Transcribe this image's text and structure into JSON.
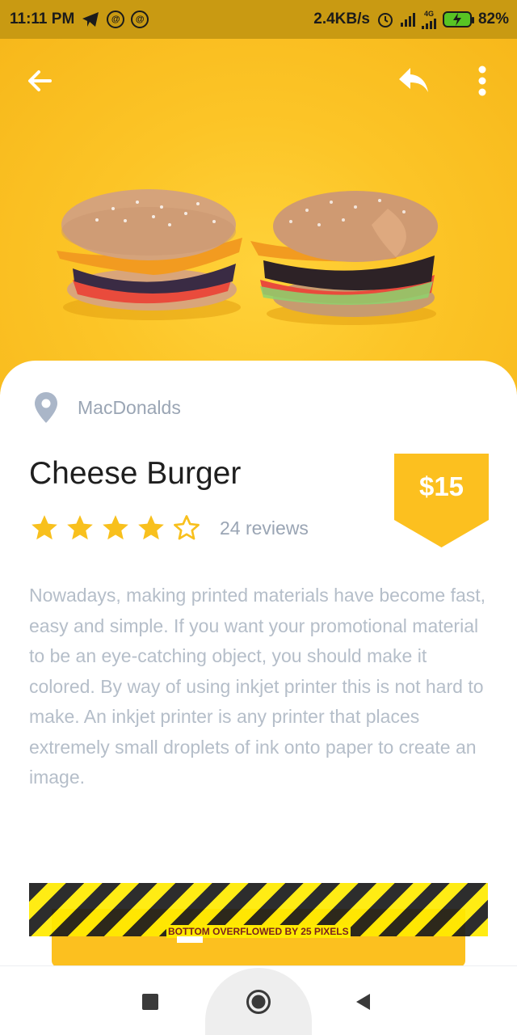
{
  "status_bar": {
    "time": "11:11 PM",
    "network_speed": "2.4KB/s",
    "network_type": "4G",
    "battery": "82%",
    "icons": [
      "telegram-icon",
      "sync-icon",
      "sync-icon",
      "alarm-icon",
      "signal-icon",
      "signal-icon",
      "battery-charging-icon"
    ]
  },
  "app_bar": {
    "icons": [
      "back-arrow-icon",
      "share-icon",
      "more-vert-icon"
    ]
  },
  "product": {
    "location_icon": "location-pin-icon",
    "location": "MacDonalds",
    "title": "Cheese Burger",
    "rating": 4,
    "rating_max": 5,
    "reviews": "24 reviews",
    "price": "$15",
    "description": "Nowadays, making printed materials have become fast, easy and simple. If you want your promotional material to be an eye-catching object, you should make it colored. By way of using inkjet printer this is not hard to make. An inkjet printer is any printer that places extremely small droplets of ink onto paper to create an image."
  },
  "overflow_warning": "BOTTOM OVERFLOWED BY 25 PIXELS",
  "nav_bar": {
    "icons": [
      "recents-square-icon",
      "home-circle-icon",
      "back-triangle-icon"
    ]
  },
  "colors": {
    "accent": "#fcc01f",
    "status_bar": "#c99a12",
    "muted_text": "#9aa5b4",
    "description_text": "#b5bec9",
    "title_text": "#1f1f1f"
  }
}
